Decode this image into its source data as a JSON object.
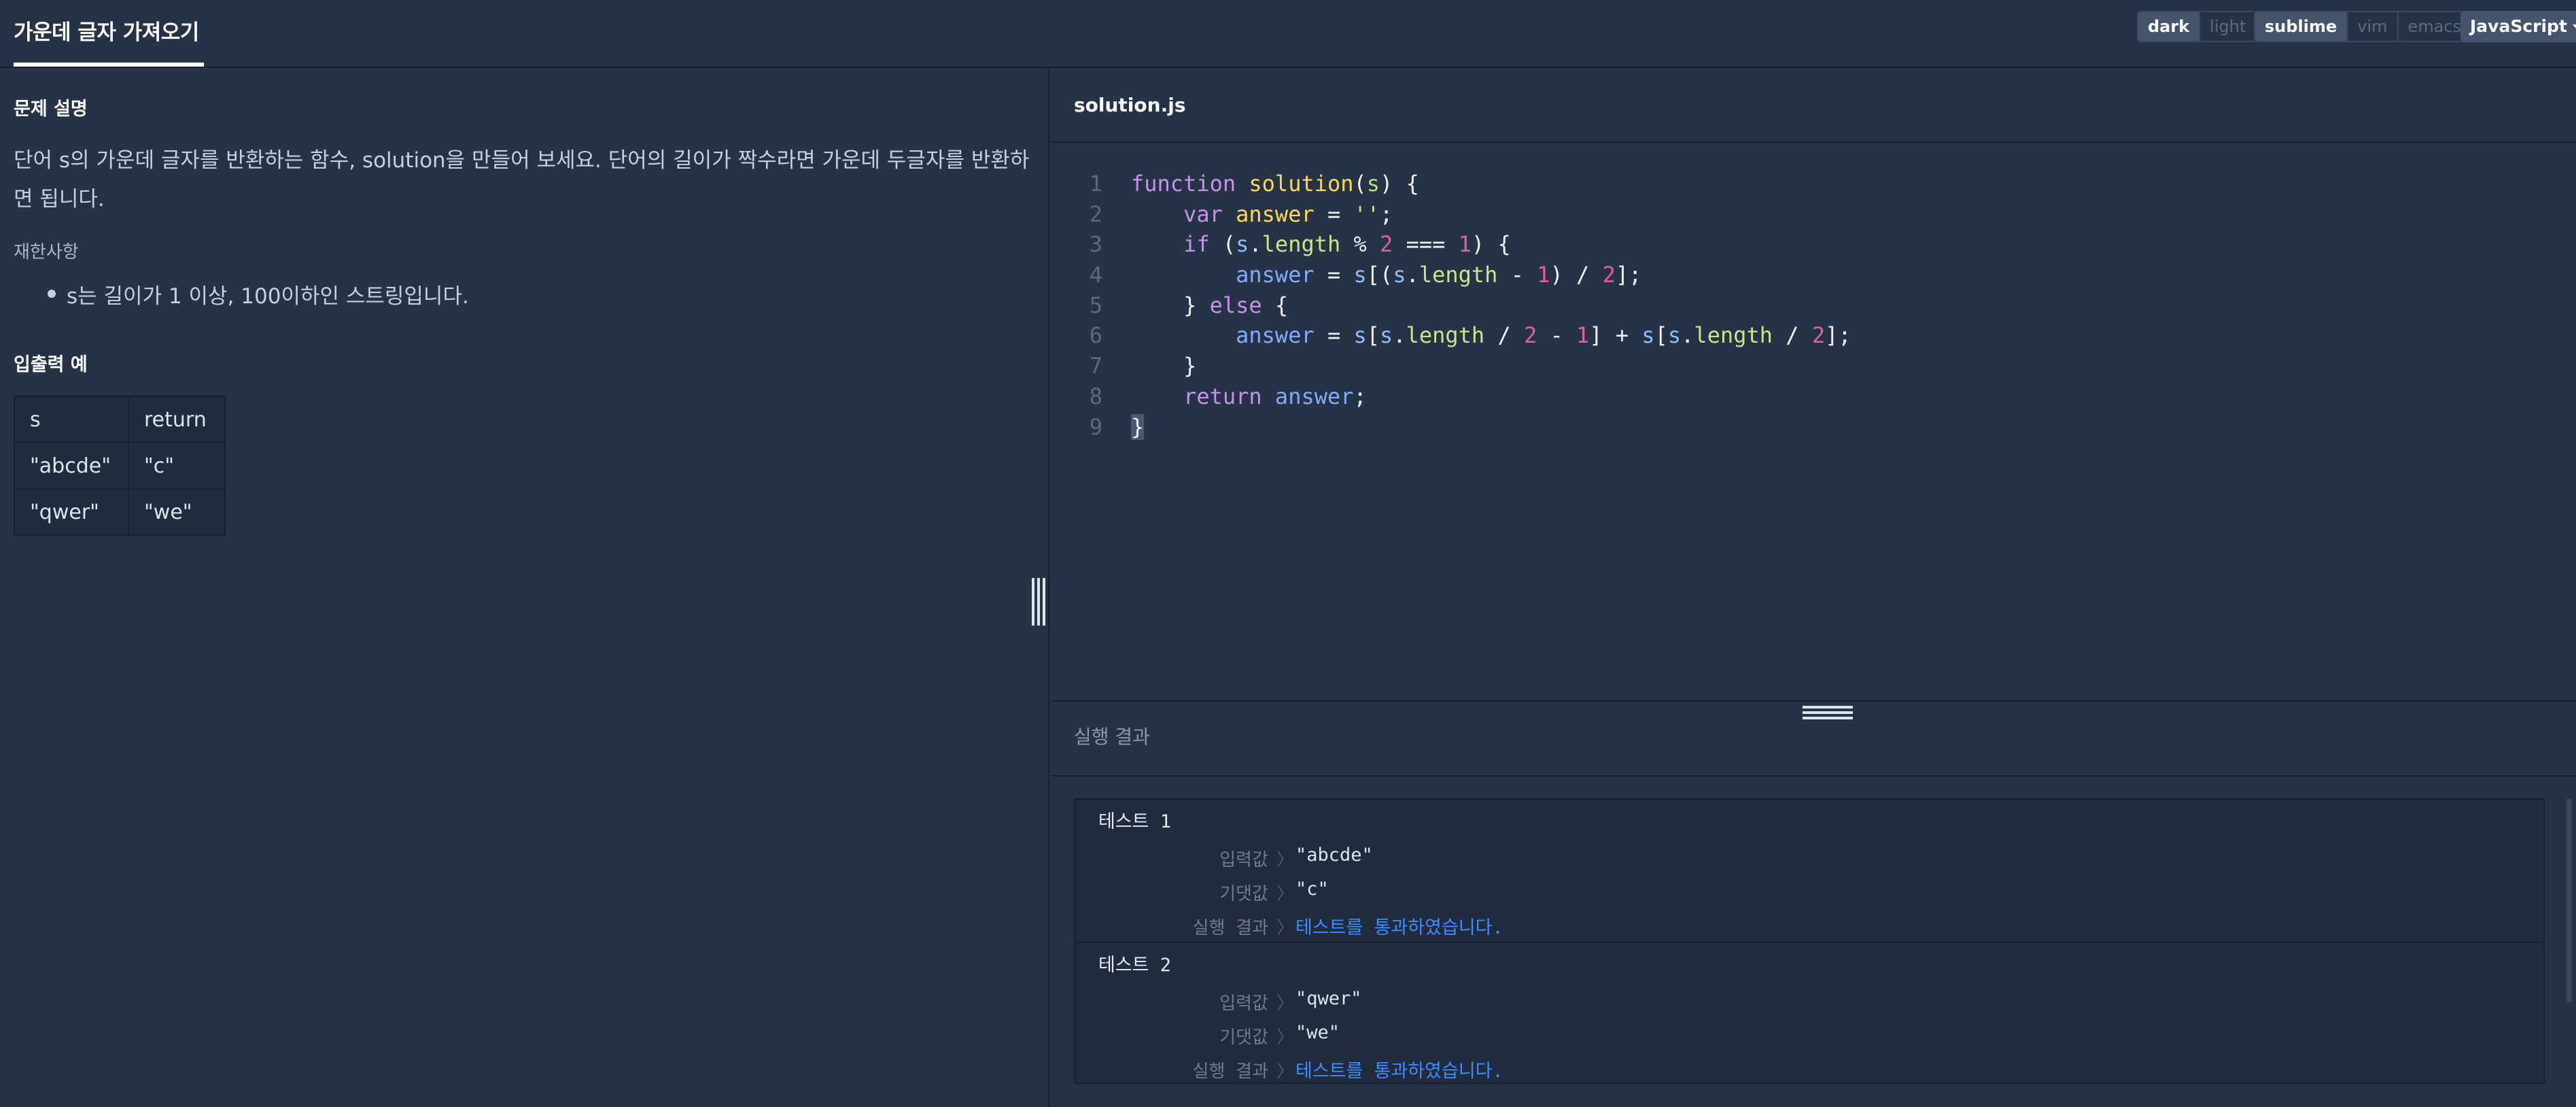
{
  "header": {
    "title": "가운데 글자 가져오기",
    "theme_options": [
      {
        "label": "dark",
        "active": true
      },
      {
        "label": "light",
        "active": false
      }
    ],
    "keymap_options": [
      {
        "label": "sublime",
        "active": true
      },
      {
        "label": "vim",
        "active": false
      },
      {
        "label": "emacs",
        "active": false
      }
    ],
    "language": "JavaScript"
  },
  "problem": {
    "section_title": "문제 설명",
    "description": "단어 s의 가운데 글자를 반환하는 함수, solution을 만들어 보세요. 단어의 길이가 짝수라면 가운데 두글자를 반환하면 됩니다.",
    "constraints_title": "재한사항",
    "constraints": [
      "s는 길이가 1 이상, 100이하인 스트링입니다."
    ],
    "examples_title": "입출력 예",
    "examples_table": {
      "headers": [
        "s",
        "return"
      ],
      "rows": [
        [
          "\"abcde\"",
          "\"c\""
        ],
        [
          "\"qwer\"",
          "\"we\""
        ]
      ]
    }
  },
  "editor": {
    "file_name": "solution.js",
    "line_numbers": [
      "1",
      "2",
      "3",
      "4",
      "5",
      "6",
      "7",
      "8",
      "9"
    ],
    "code_lines": [
      "function solution(s) {",
      "    var answer = '';",
      "    if (s.length % 2 === 1) {",
      "        answer = s[(s.length - 1) / 2];",
      "    } else {",
      "        answer = s[s.length / 2 - 1] + s[s.length / 2];",
      "    }",
      "    return answer;",
      "}"
    ]
  },
  "results": {
    "title": "실행 결과",
    "tests": [
      {
        "name": "테스트 1",
        "input_label": "입력값",
        "input": "\"abcde\"",
        "expected_label": "기댓값",
        "expected": "\"c\"",
        "result_label": "실행 결과",
        "result": "테스트를 통과하였습니다."
      },
      {
        "name": "테스트 2",
        "input_label": "입력값",
        "input": "\"qwer\"",
        "expected_label": "기댓값",
        "expected": "\"we\"",
        "result_label": "실행 결과",
        "result": "테스트를 통과하였습니다."
      }
    ],
    "separator_glyph": "〉"
  },
  "colors": {
    "background": "#263245",
    "console_background": "#202b3d",
    "pass_text": "#3d8bff",
    "keyword": "#c792ea",
    "function_name": "#ffd84d",
    "number": "#e0609a"
  }
}
